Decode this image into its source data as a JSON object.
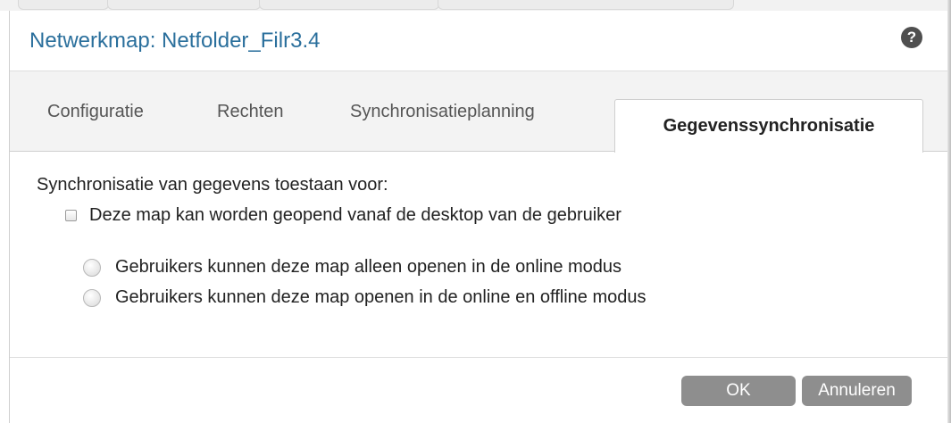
{
  "dialog": {
    "title": "Netwerkmap: Netfolder_Filr3.4",
    "help_icon": "question-circle-icon"
  },
  "tabs": [
    {
      "label": "Configuratie",
      "active": false
    },
    {
      "label": "Rechten",
      "active": false
    },
    {
      "label": "Synchronisatieplanning",
      "active": false
    },
    {
      "label": "Gegevenssynchronisatie",
      "active": true
    }
  ],
  "content": {
    "section_label": "Synchronisatie van gegevens toestaan voor:",
    "checkbox": {
      "label": "Deze map kan worden geopend vanaf de desktop van de gebruiker",
      "checked": false
    },
    "radios": [
      {
        "label": "Gebruikers kunnen deze map alleen openen in de online modus",
        "selected": false
      },
      {
        "label": "Gebruikers kunnen deze map openen in de online en offline modus",
        "selected": false
      }
    ]
  },
  "footer": {
    "ok_label": "OK",
    "cancel_label": "Annuleren"
  },
  "colors": {
    "title": "#2a6f9c",
    "button": "#8e8e8e",
    "tabbar_bg": "#f3f3f3"
  }
}
